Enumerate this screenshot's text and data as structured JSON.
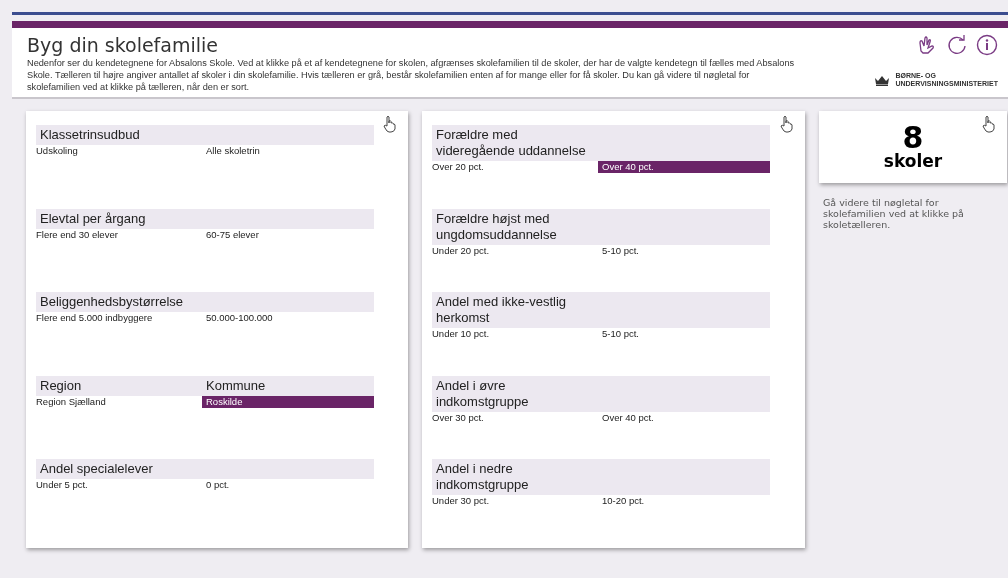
{
  "header": {
    "title": "Byg din skolefamilie",
    "description": "Nedenfor ser du kendetegnene for Absalons Skole. Ved at klikke på et af kendetegnene for skolen, afgrænses skolefamilien til de skoler, der har de valgte kendetegn til fælles med Absalons Skole. Tælleren til højre angiver antallet af skoler i din skolefamilie. Hvis tælleren er grå, består skolefamilien enten af for mange eller for få skoler. Du kan gå videre til nøgletal for skolefamilien ved at klikke på tælleren, når den er sort.",
    "logo_text": [
      "BØRNE- OG",
      "UNDERVISNINGSMINISTERIET"
    ]
  },
  "panels": [
    {
      "blocks": [
        {
          "headings": [
            "Klassetrinsudbud"
          ],
          "values": [
            {
              "text": "Udskoling",
              "selected": false
            },
            {
              "text": "Alle skoletrin",
              "selected": false
            }
          ]
        },
        {
          "headings": [
            "Elevtal per årgang"
          ],
          "values": [
            {
              "text": "Flere end 30 elever",
              "selected": false
            },
            {
              "text": "60-75 elever",
              "selected": false
            }
          ]
        },
        {
          "headings": [
            "Beliggenhedsbystørrelse"
          ],
          "values": [
            {
              "text": "Flere end 5.000 indbyggere",
              "selected": false
            },
            {
              "text": "50.000-100.000",
              "selected": false
            }
          ]
        },
        {
          "headings": [
            "Region",
            "Kommune"
          ],
          "values": [
            {
              "text": "Region Sjælland",
              "selected": false
            },
            {
              "text": "Roskilde",
              "selected": true
            }
          ]
        },
        {
          "headings": [
            "Andel specialelever"
          ],
          "values": [
            {
              "text": "Under 5 pct.",
              "selected": false
            },
            {
              "text": "0 pct.",
              "selected": false
            }
          ]
        }
      ]
    },
    {
      "blocks": [
        {
          "headings": [
            "Forældre med videregående uddannelse"
          ],
          "values": [
            {
              "text": "Over 20 pct.",
              "selected": false
            },
            {
              "text": "Over 40 pct.",
              "selected": true
            }
          ]
        },
        {
          "headings": [
            "Forældre højst med ungdomsuddannelse"
          ],
          "values": [
            {
              "text": "Under 20 pct.",
              "selected": false
            },
            {
              "text": "5-10 pct.",
              "selected": false
            }
          ]
        },
        {
          "headings": [
            "Andel med ikke-vestlig herkomst"
          ],
          "values": [
            {
              "text": "Under 10 pct.",
              "selected": false
            },
            {
              "text": "5-10 pct.",
              "selected": false
            }
          ]
        },
        {
          "headings": [
            "Andel i øvre indkomstgruppe"
          ],
          "values": [
            {
              "text": "Over 30 pct.",
              "selected": false
            },
            {
              "text": "Over 40 pct.",
              "selected": false
            }
          ]
        },
        {
          "headings": [
            "Andel i nedre indkomstgruppe"
          ],
          "values": [
            {
              "text": "Under 30 pct.",
              "selected": false
            },
            {
              "text": "10-20 pct.",
              "selected": false
            }
          ]
        }
      ]
    }
  ],
  "counter": {
    "count": "8",
    "unit": "skoler",
    "note": "Gå videre til nøgletal for skolefamilien ved at klikke på skoletælleren."
  }
}
